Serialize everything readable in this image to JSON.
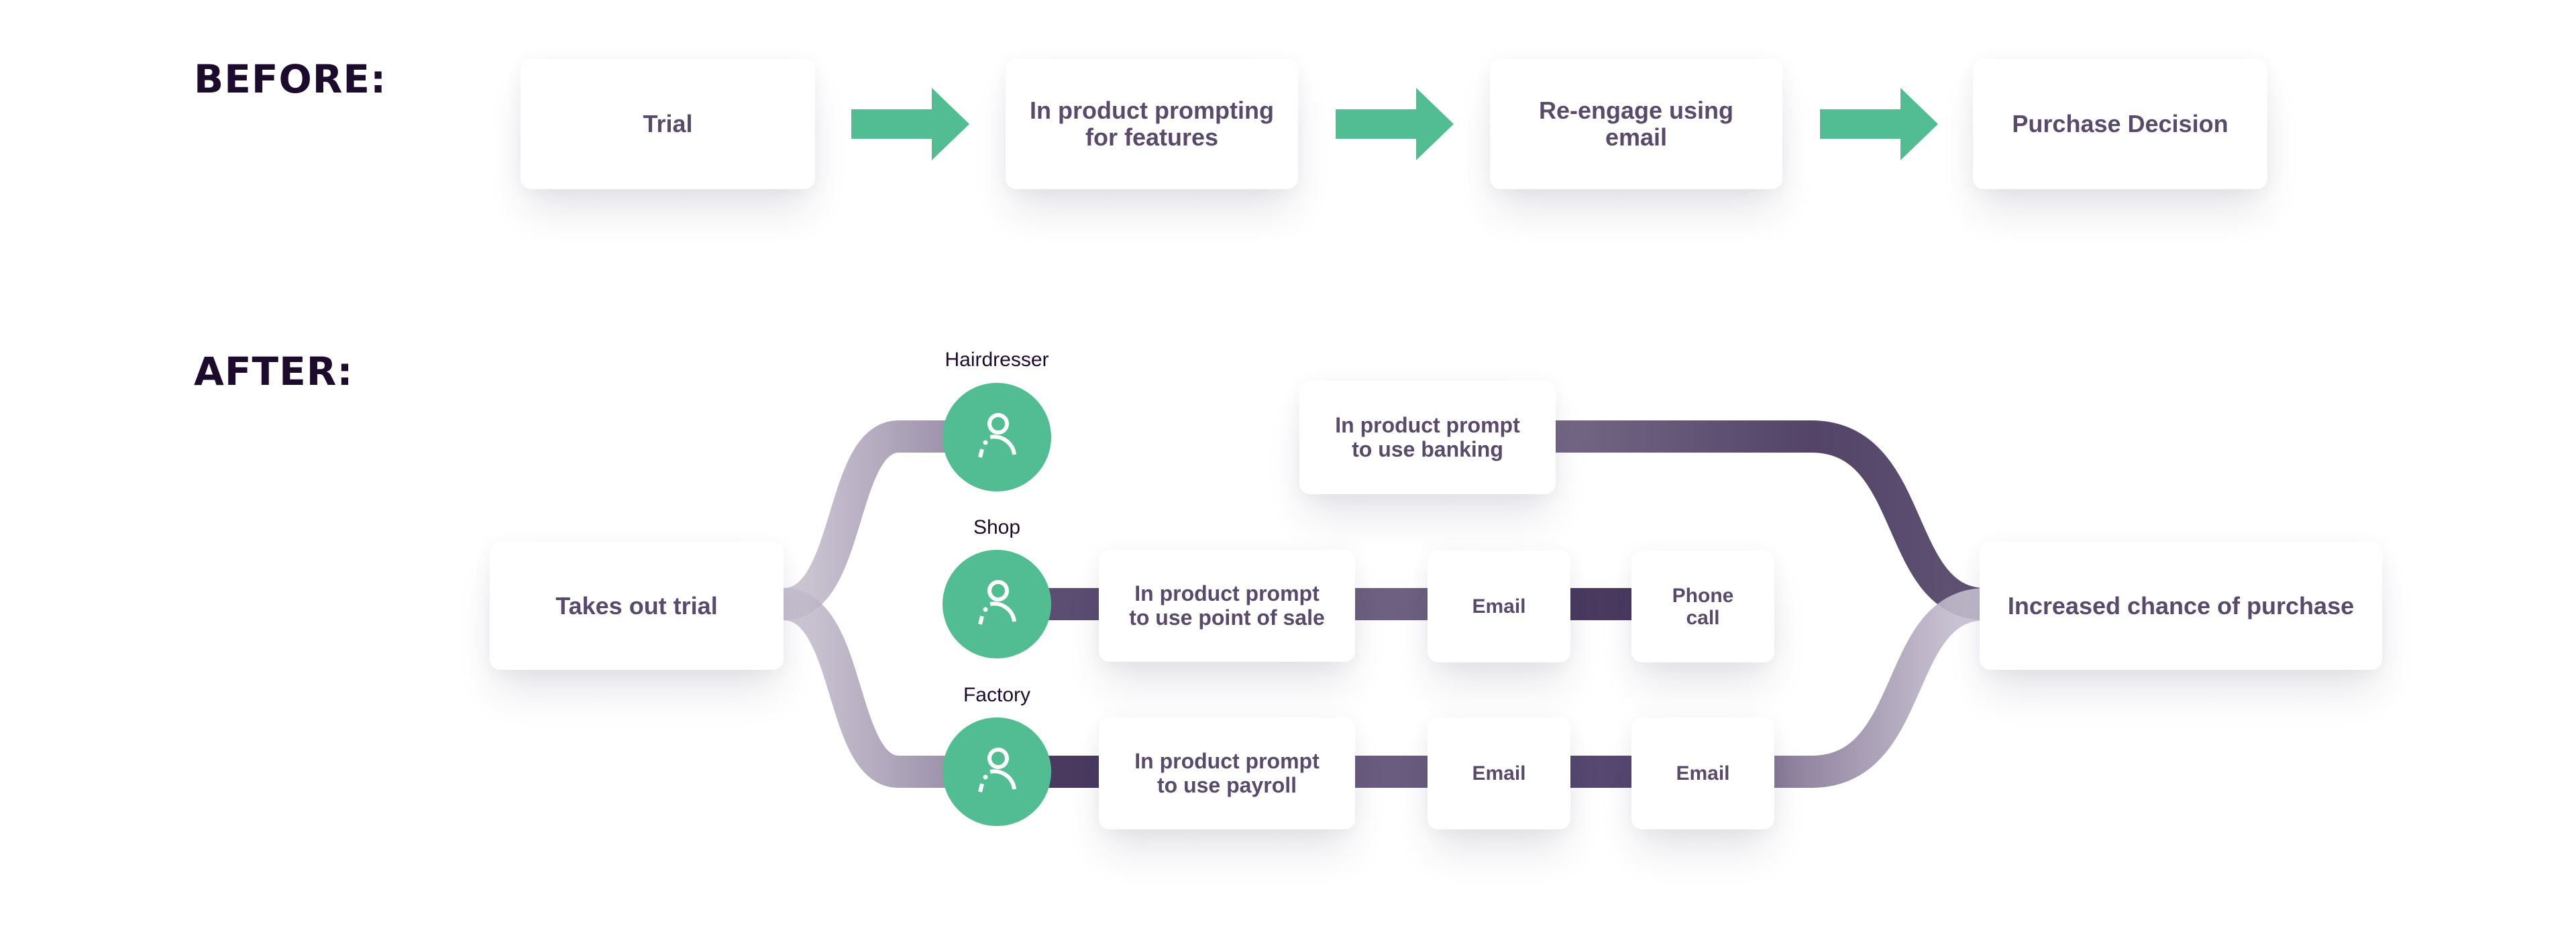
{
  "colors": {
    "accent_green": "#52bd93",
    "card_text": "#594a6b",
    "heading_text": "#1d0b2e",
    "connector_dark": "#4a3a60",
    "connector_light": "#c9c3d2"
  },
  "before": {
    "label": "BEFORE:",
    "steps": [
      {
        "label": "Trial"
      },
      {
        "label": "In product prompting\nfor features"
      },
      {
        "label": "Re-engage using\nemail"
      },
      {
        "label": "Purchase Decision"
      }
    ],
    "arrow_icon": "right-arrow-icon"
  },
  "after": {
    "label": "AFTER:",
    "start": {
      "label": "Takes out trial"
    },
    "end": {
      "label": "Increased chance of purchase"
    },
    "persona_icon": "user-icon",
    "paths": [
      {
        "persona": "Hairdresser",
        "steps": [
          {
            "label": "In product prompt\nto use banking"
          }
        ]
      },
      {
        "persona": "Shop",
        "steps": [
          {
            "label": "In product prompt\nto use point of sale"
          },
          {
            "label": "Email"
          },
          {
            "label": "Phone\ncall"
          }
        ]
      },
      {
        "persona": "Factory",
        "steps": [
          {
            "label": "In product prompt\nto use payroll"
          },
          {
            "label": "Email"
          },
          {
            "label": "Email"
          }
        ]
      }
    ]
  }
}
